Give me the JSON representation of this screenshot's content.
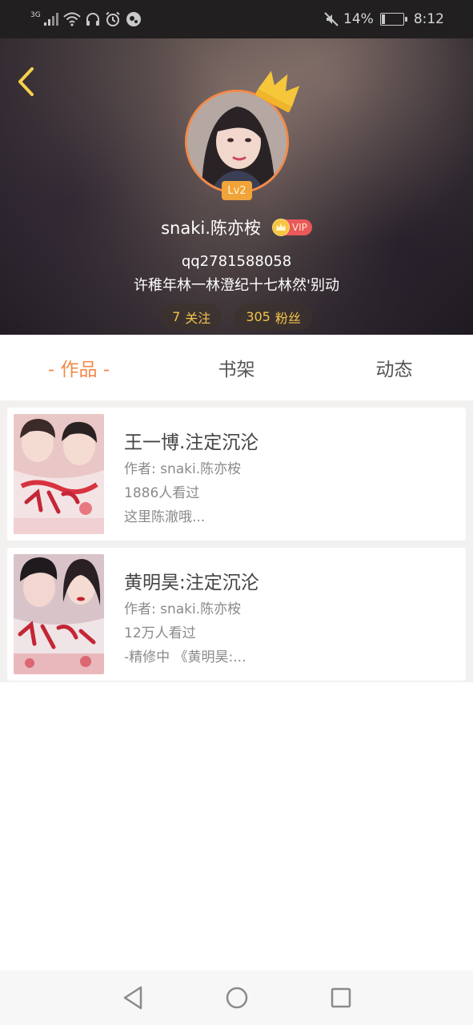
{
  "status_bar": {
    "network_type": "3G",
    "battery_percent": "14%",
    "battery_level": 0.14,
    "time": "8:12",
    "icons": [
      "signal-icon",
      "wifi-icon",
      "headset-icon",
      "alarm-icon",
      "app-icon",
      "mute-icon",
      "battery-icon"
    ]
  },
  "profile": {
    "level": "Lv2",
    "username": "snaki.陈亦桉",
    "vip_label": "VIP",
    "qq": "qq2781588058",
    "signature": "许稚年林一林澄纪十七林然'别动",
    "following_count": "7",
    "following_label": "关注",
    "followers_count": "305",
    "followers_label": "粉丝"
  },
  "tabs": [
    {
      "label": "- 作品 -",
      "active": true
    },
    {
      "label": "书架",
      "active": false
    },
    {
      "label": "动态",
      "active": false
    }
  ],
  "works": [
    {
      "title": "王一博.注定沉沦",
      "author": "作者: snaki.陈亦桉",
      "views": "1886人看过",
      "excerpt": "这里陈澈哦..."
    },
    {
      "title": "黄明昊:注定沉沦",
      "author": "作者: snaki.陈亦桉",
      "views": "12万人看过",
      "excerpt": "-精修中 《黄明昊:..."
    }
  ],
  "colors": {
    "accent": "#f08a4b",
    "gold": "#f5c44a",
    "vip_red": "#e9585a"
  }
}
